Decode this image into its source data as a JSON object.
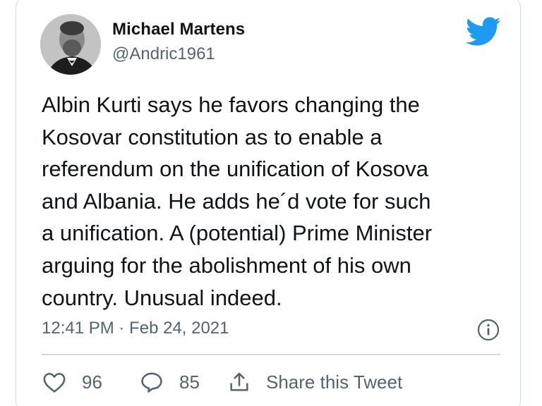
{
  "author": {
    "name": "Michael Martens",
    "handle": "@Andric1961"
  },
  "tweet": {
    "lines": [
      "Albin Kurti says he favors changing the",
      "Kosovar constitution as to enable a",
      "referendum on the unification of Kosova",
      "and Albania. He adds he´d vote for such",
      "a unification. A (potential) Prime Minister",
      "arguing for the abolishment of his own",
      "country. Unusual indeed."
    ],
    "timestamp": "12:41 PM · Feb 24, 2021"
  },
  "actions": {
    "likes": "96",
    "replies": "85",
    "share_label": "Share this Tweet"
  },
  "icons": {
    "brand": "twitter-bird-icon",
    "info": "info-icon",
    "like": "heart-icon",
    "reply": "speech-bubble-icon",
    "share": "share-icon"
  },
  "colors": {
    "brand": "#1d9bf0",
    "text": "#0f1419",
    "secondary": "#536471",
    "border": "#cfd9de"
  }
}
